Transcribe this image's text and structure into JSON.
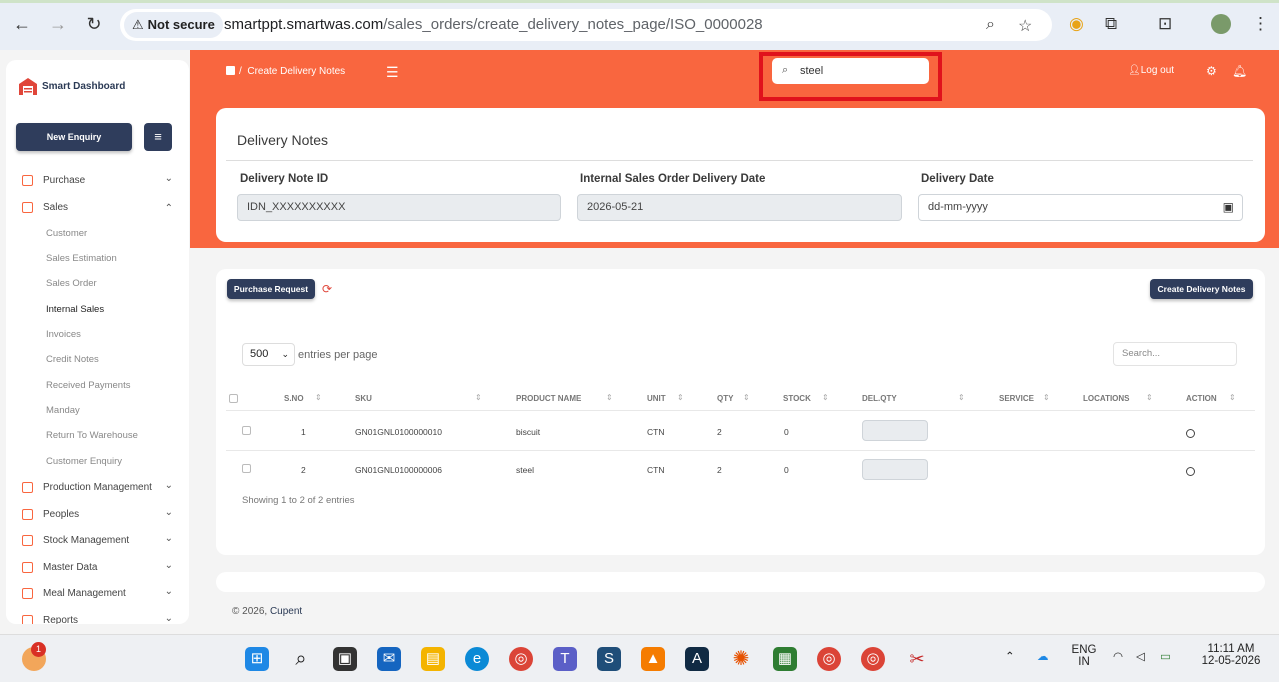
{
  "browser": {
    "security_label": "Not secure",
    "url_host": "smartppt.smartwas.com",
    "url_path": "/sales_orders/create_delivery_notes_page/ISO_0000028"
  },
  "header": {
    "breadcrumb_sep": "/",
    "breadcrumb": "Create Delivery Notes",
    "search_value": "steel",
    "logout_label": "Log out"
  },
  "sidebar": {
    "brand": "Smart Dashboard",
    "new_enquiry": "New Enquiry",
    "items": [
      {
        "label": "Purchase",
        "chev": "⌄"
      },
      {
        "label": "Sales",
        "chev": "⌃"
      },
      {
        "label": "Production Management",
        "chev": "⌄"
      },
      {
        "label": "Peoples",
        "chev": "⌄"
      },
      {
        "label": "Stock Management",
        "chev": "⌄"
      },
      {
        "label": "Master Data",
        "chev": "⌄"
      },
      {
        "label": "Meal Management",
        "chev": "⌄"
      },
      {
        "label": "Reports",
        "chev": "⌄"
      }
    ],
    "sales_sub": [
      "Customer",
      "Sales Estimation",
      "Sales Order",
      "Internal Sales",
      "Invoices",
      "Credit Notes",
      "Received Payments",
      "Manday",
      "Return To Warehouse",
      "Customer Enquiry"
    ]
  },
  "delivery": {
    "title": "Delivery Notes",
    "id_label": "Delivery Note ID",
    "id_value": "IDN_XXXXXXXXXX",
    "iso_date_label": "Internal Sales Order Delivery Date",
    "iso_date_value": "2026-05-21",
    "date_label": "Delivery Date",
    "date_placeholder": "dd-mm-yyyy"
  },
  "table": {
    "purchase_request": "Purchase Request",
    "create_button": "Create Delivery Notes",
    "length_value": "500",
    "length_label": "entries per page",
    "search_placeholder": "Search...",
    "columns": [
      "S.NO",
      "SKU",
      "PRODUCT NAME",
      "UNIT",
      "QTY",
      "STOCK",
      "DEL.QTY",
      "SERVICE",
      "LOCATIONS",
      "ACTION"
    ],
    "rows": [
      {
        "sno": "1",
        "sku": "GN01GNL0100000010",
        "product": "biscuit",
        "unit": "CTN",
        "qty": "2",
        "stock": "0"
      },
      {
        "sno": "2",
        "sku": "GN01GNL0100000006",
        "product": "steel",
        "unit": "CTN",
        "qty": "2",
        "stock": "0"
      }
    ],
    "info": "Showing 1 to 2 of 2 entries"
  },
  "footer": {
    "copyright": "© 2026,",
    "company": "Cupent"
  },
  "taskbar": {
    "badge": "1",
    "lang_top": "ENG",
    "lang_bottom": "IN",
    "time": "11:11 AM",
    "date": "12-05-2026"
  },
  "colors": {
    "accent": "#f9663f",
    "dark_button": "#2f3d5c",
    "highlight_box": "#e0121c"
  }
}
